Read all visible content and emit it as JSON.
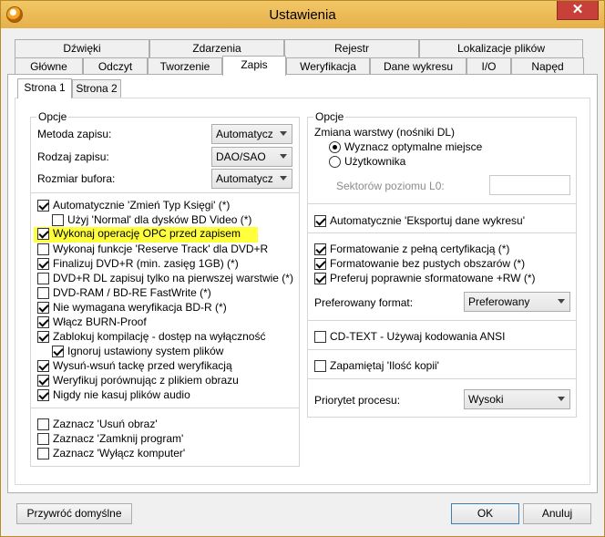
{
  "window": {
    "title": "Ustawienia",
    "close_label": "✕"
  },
  "tabs_row1": [
    "Dźwięki",
    "Zdarzenia",
    "Rejestr",
    "Lokalizacje plików"
  ],
  "tabs_row2": [
    "Główne",
    "Odczyt",
    "Tworzenie",
    "Zapis",
    "Weryfikacja",
    "Dane wykresu",
    "I/O",
    "Napęd"
  ],
  "active_tab": "Zapis",
  "subtabs": [
    "Strona 1",
    "Strona 2"
  ],
  "left": {
    "legend": "Opcje",
    "fields": [
      {
        "label": "Metoda zapisu:",
        "value": "Automatycz"
      },
      {
        "label": "Rodzaj zapisu:",
        "value": "DAO/SAO"
      },
      {
        "label": "Rozmiar bufora:",
        "value": "Automatycz"
      }
    ],
    "checks": [
      {
        "label": "Automatycznie 'Zmień Typ Księgi' (*)",
        "checked": true
      },
      {
        "label": "Użyj 'Normal' dla dysków BD Video (*)",
        "checked": false
      },
      {
        "label": "Wykonaj operację OPC przed zapisem",
        "checked": true
      },
      {
        "label": "Wykonaj funkcje 'Reserve Track' dla DVD+R",
        "checked": false
      },
      {
        "label": "Finalizuj DVD+R (min. zasięg 1GB) (*)",
        "checked": true
      },
      {
        "label": "DVD+R DL zapisuj tylko na pierwszej warstwie (*)",
        "checked": false
      },
      {
        "label": "DVD-RAM / BD-RE FastWrite (*)",
        "checked": false
      },
      {
        "label": "Nie wymagana weryfikacja BD-R (*)",
        "checked": true
      },
      {
        "label": "Włącz BURN-Proof",
        "checked": true
      },
      {
        "label": "Zablokuj kompilację - dostęp na wyłączność",
        "checked": true
      },
      {
        "label": "Ignoruj ustawiony system plików",
        "checked": true
      },
      {
        "label": "Wysuń-wsuń tackę przed weryfikacją",
        "checked": true
      },
      {
        "label": "Weryfikuj porównując z plikiem obrazu",
        "checked": true
      },
      {
        "label": "Nigdy nie kasuj plików audio",
        "checked": true
      }
    ],
    "checks2": [
      {
        "label": "Zaznacz 'Usuń obraz'",
        "checked": false
      },
      {
        "label": "Zaznacz 'Zamknij program'",
        "checked": false
      },
      {
        "label": "Zaznacz 'Wyłącz komputer'",
        "checked": false
      }
    ]
  },
  "right": {
    "legend": "Opcje",
    "layer_label": "Zmiana warstwy (nośniki DL)",
    "radio1": "Wyznacz optymalne miejsce",
    "radio2": "Użytkownika",
    "sectors_label": "Sektorów poziomu L0:",
    "export_label": "Automatycznie 'Eksportuj dane wykresu'",
    "format_checks": [
      {
        "label": "Formatowanie z pełną certyfikacją (*)",
        "checked": true
      },
      {
        "label": "Formatowanie bez pustych obszarów (*)",
        "checked": true
      },
      {
        "label": "Preferuj poprawnie sformatowane +RW (*)",
        "checked": true
      }
    ],
    "preferred_format_label": "Preferowany format:",
    "preferred_format_value": "Preferowany",
    "cdtext_label": "CD-TEXT - Używaj kodowania ANSI",
    "remember_label": "Zapamiętaj 'Ilość kopii'",
    "priority_label": "Priorytet procesu:",
    "priority_value": "Wysoki"
  },
  "buttons": {
    "restore": "Przywróć domyślne",
    "ok": "OK",
    "cancel": "Anuluj"
  }
}
